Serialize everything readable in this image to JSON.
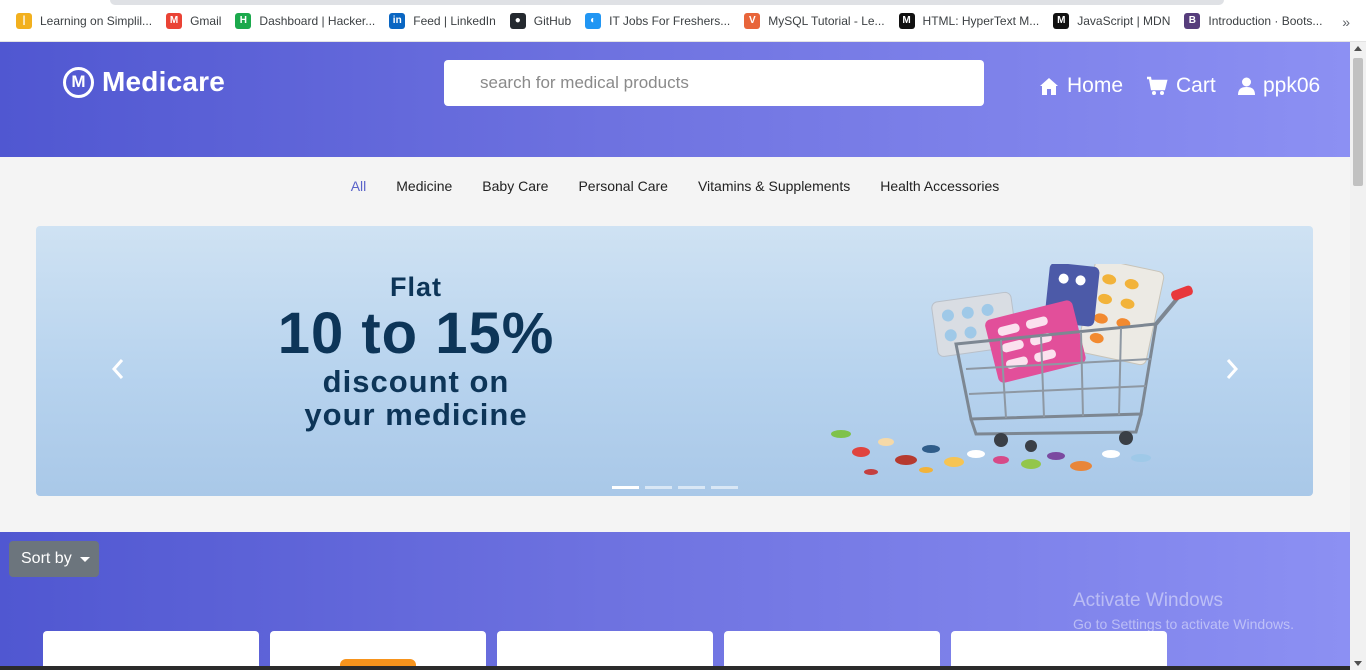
{
  "bookmarks": [
    {
      "label": "Learning on Simplil...",
      "icon": "simplilearn-icon",
      "color": "#f2b01e",
      "glyph": "|"
    },
    {
      "label": "Gmail",
      "icon": "gmail-icon",
      "color": "#ea4335",
      "glyph": "M"
    },
    {
      "label": "Dashboard | Hacker...",
      "icon": "hackerrank-icon",
      "color": "#1ba94c",
      "glyph": "H"
    },
    {
      "label": "Feed | LinkedIn",
      "icon": "linkedin-icon",
      "color": "#0a66c2",
      "glyph": "in"
    },
    {
      "label": "GitHub",
      "icon": "github-icon",
      "color": "#24292f",
      "glyph": "●"
    },
    {
      "label": "IT Jobs For Freshers...",
      "icon": "jobs-icon",
      "color": "#2196f3",
      "glyph": "◐"
    },
    {
      "label": "MySQL Tutorial - Le...",
      "icon": "vue-icon",
      "color": "#e8653a",
      "glyph": "V"
    },
    {
      "label": "HTML: HyperText M...",
      "icon": "mdn-icon",
      "color": "#111111",
      "glyph": "M"
    },
    {
      "label": "JavaScript | MDN",
      "icon": "mdn-icon",
      "color": "#111111",
      "glyph": "M"
    },
    {
      "label": "Introduction · Boots...",
      "icon": "bootstrap-icon",
      "color": "#563d7c",
      "glyph": "B"
    }
  ],
  "bookmarks_more": "»",
  "header": {
    "brand_glyph": "M",
    "brand": "Medicare",
    "search_placeholder": "search for medical products",
    "nav": {
      "home": "Home",
      "cart": "Cart",
      "user": "ppk06"
    },
    "gradient": [
      "#5057d1",
      "#8c90f3"
    ]
  },
  "categories": [
    "All",
    "Medicine",
    "Baby Care",
    "Personal Care",
    "Vitamins & Supplements",
    "Health Accessories"
  ],
  "active_category": "All",
  "carousel": {
    "line1": "Flat",
    "line2": "10 to 15%",
    "line3": "discount on",
    "line4": "your medicine",
    "slides": 4,
    "active_slide": 1
  },
  "products": {
    "sort_label": "Sort by",
    "card_count": 5
  },
  "watermark": {
    "line1": "Activate Windows",
    "line2": "Go to Settings to activate Windows."
  }
}
